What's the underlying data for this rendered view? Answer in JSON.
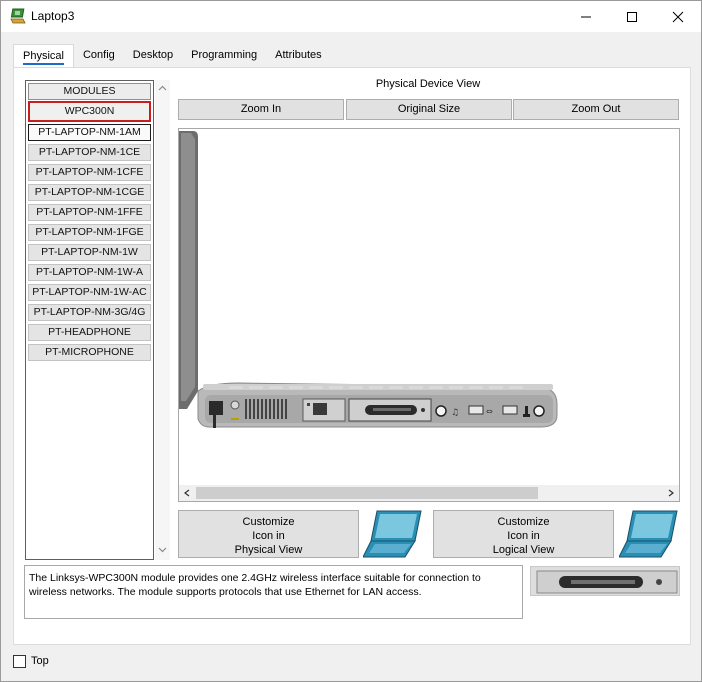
{
  "window": {
    "title": "Laptop3",
    "app_icon": "packet-tracer-laptop-icon"
  },
  "titlebar_buttons": {
    "minimize": "minimize-icon",
    "maximize": "maximize-icon",
    "close": "close-icon"
  },
  "tabs": [
    {
      "label": "Physical",
      "active": true
    },
    {
      "label": "Config",
      "active": false
    },
    {
      "label": "Desktop",
      "active": false
    },
    {
      "label": "Programming",
      "active": false
    },
    {
      "label": "Attributes",
      "active": false
    }
  ],
  "modules": {
    "header": "MODULES",
    "items": [
      "WPC300N",
      "PT-LAPTOP-NM-1AM",
      "PT-LAPTOP-NM-1CE",
      "PT-LAPTOP-NM-1CFE",
      "PT-LAPTOP-NM-1CGE",
      "PT-LAPTOP-NM-1FFE",
      "PT-LAPTOP-NM-1FGE",
      "PT-LAPTOP-NM-1W",
      "PT-LAPTOP-NM-1W-A",
      "PT-LAPTOP-NM-1W-AC",
      "PT-LAPTOP-NM-3G/4G",
      "PT-HEADPHONE",
      "PT-MICROPHONE"
    ],
    "selected_index": 0
  },
  "device_view": {
    "title": "Physical Device View",
    "zoom_in": "Zoom In",
    "original_size": "Original Size",
    "zoom_out": "Zoom Out"
  },
  "customize": {
    "physical": {
      "line1": "Customize",
      "line2": "Icon in",
      "line3": "Physical View"
    },
    "logical": {
      "line1": "Customize",
      "line2": "Icon in",
      "line3": "Logical View"
    }
  },
  "description": "The Linksys-WPC300N module provides one 2.4GHz wireless interface suitable for connection to wireless networks. The module supports protocols that use Ethernet for LAN access.",
  "footer": {
    "top_label": "Top",
    "top_checked": false
  },
  "colors": {
    "selected_border": "#c81e1e",
    "tab_underline": "#1e6cc8",
    "laptop_teal": "#2a8fb5"
  }
}
